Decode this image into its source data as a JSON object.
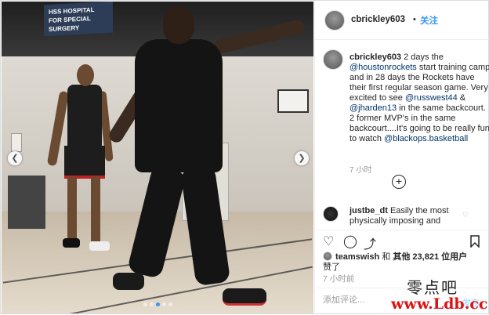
{
  "header": {
    "username": "cbrickley603",
    "separator": "•",
    "follow_label": "关注"
  },
  "photo": {
    "sign_text": "HSS HOSPITAL FOR SPECIAL SURGERY",
    "prev_icon": "chevron-left-icon",
    "next_icon": "chevron-right-icon",
    "carousel_count": 5,
    "carousel_active": 2
  },
  "caption": {
    "username": "cbrickley603",
    "t1": " 2 days the ",
    "m1": "@houstonrockets",
    "t2": " start training camp and in 28 days the Rockets have their first regular season game. Very excited to see ",
    "m2": "@russwest44",
    "t3": " & ",
    "m3": "@jharden13",
    "t4": " in the same backcourt. 2 former MVP's in the same backcourt....It's going to be really fun to watch ",
    "m4": "@blackops.basketball",
    "time": "7 小时"
  },
  "load_more_icon": "plus-circle-icon",
  "comment": {
    "username": "justbe_dt",
    "text": " Easily the most physically imposing and",
    "heart_icon": "heart-icon"
  },
  "actions": {
    "like_icon": "heart-icon",
    "comment_icon": "comment-icon",
    "share_icon": "share-icon",
    "save_icon": "bookmark-icon"
  },
  "likes": {
    "user": "teamswish",
    "t1": " 和 ",
    "others_label": "其他 23,821 位用户",
    "t2": "赞了"
  },
  "time2": "7 小时前",
  "add_comment": {
    "placeholder": "添加评论...",
    "post_label": "发布"
  },
  "watermark": {
    "line1": "零点吧",
    "line2": "www.Ldb.cc"
  },
  "colors": {
    "accent": "#3897f0",
    "mention": "#003569",
    "muted": "#999999"
  }
}
